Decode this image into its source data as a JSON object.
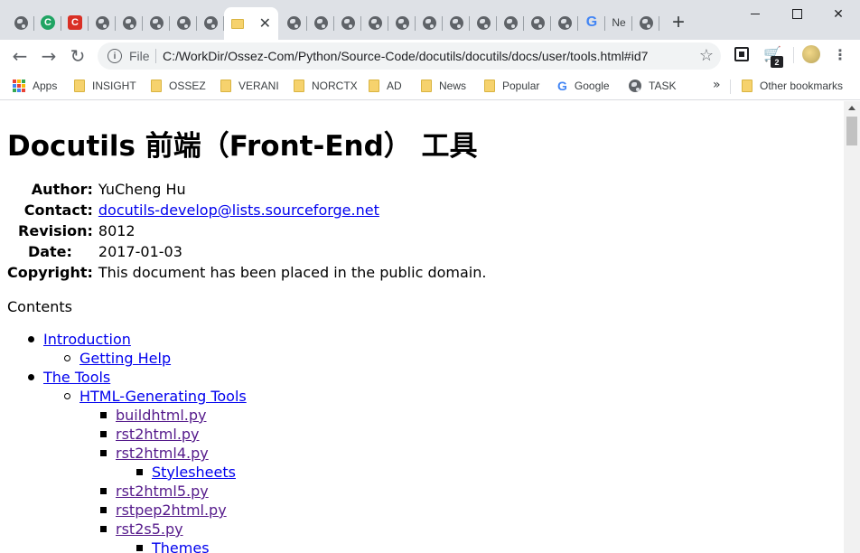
{
  "window": {
    "controls": {
      "minimize_icon": "minimize-icon",
      "maximize_icon": "maximize-icon",
      "close_label": "✕"
    }
  },
  "tabs": [
    {
      "favicon": "globe-icon"
    },
    {
      "favicon": "c-green-icon",
      "glyph": "C"
    },
    {
      "favicon": "c-red-icon",
      "glyph": "C"
    },
    {
      "favicon": "globe-icon"
    },
    {
      "favicon": "globe-icon"
    },
    {
      "favicon": "globe-icon"
    },
    {
      "favicon": "globe-icon"
    },
    {
      "favicon": "globe-icon"
    },
    {
      "favicon": "folder-icon",
      "active": true,
      "close_label": "✕"
    },
    {
      "favicon": "globe-icon"
    },
    {
      "favicon": "globe-icon"
    },
    {
      "favicon": "globe-icon"
    },
    {
      "favicon": "globe-icon"
    },
    {
      "favicon": "globe-icon"
    },
    {
      "favicon": "globe-icon"
    },
    {
      "favicon": "globe-icon"
    },
    {
      "favicon": "globe-icon"
    },
    {
      "favicon": "globe-icon"
    },
    {
      "favicon": "globe-icon"
    },
    {
      "favicon": "globe-icon"
    },
    {
      "favicon": "google-icon",
      "glyph": "G"
    },
    {
      "favicon": "text-icon",
      "glyph": "Ne"
    },
    {
      "favicon": "globe-icon"
    }
  ],
  "new_tab_label": "+",
  "toolbar": {
    "back_label": "←",
    "forward_label": "→",
    "reload_label": "↻",
    "omnibox": {
      "info_label": "i",
      "scheme": "File",
      "url": "C:/WorkDir/Ossez-Com/Python/Source-Code/docutils/docutils/docs/user/tools.html#id7",
      "star_label": "☆"
    },
    "extension_badge": "2",
    "menu_label": "⋮"
  },
  "bookmarks": {
    "items": [
      {
        "label": "Apps",
        "icon": "apps-grid-icon"
      },
      {
        "label": "INSIGHT",
        "icon": "folder-icon"
      },
      {
        "label": "OSSEZ",
        "icon": "folder-icon"
      },
      {
        "label": "VERANI",
        "icon": "folder-icon"
      },
      {
        "label": "NORCTX",
        "icon": "folder-icon"
      },
      {
        "label": "AD",
        "icon": "folder-icon"
      },
      {
        "label": "News",
        "icon": "folder-icon"
      },
      {
        "label": "Popular",
        "icon": "folder-icon"
      },
      {
        "label": "Google",
        "icon": "google-icon"
      },
      {
        "label": "TASK",
        "icon": "globe-icon"
      }
    ],
    "overflow_label": "»",
    "other_label": "Other bookmarks",
    "apps_colors": [
      "#ea4335",
      "#fbbc05",
      "#34a853",
      "#4285f4",
      "#ea4335",
      "#fbbc05",
      "#34a853",
      "#4285f4",
      "#ea4335"
    ]
  },
  "page": {
    "title": "Docutils 前端（Front-End） 工具",
    "docinfo": {
      "author_label": "Author:",
      "author": "YuCheng Hu",
      "contact_label": "Contact:",
      "contact": "docutils-develop@lists.sourceforge.net",
      "revision_label": "Revision:",
      "revision": "8012",
      "date_label": "Date:",
      "date": "2017-01-03",
      "copyright_label": "Copyright:",
      "copyright": "This document has been placed in the public domain."
    },
    "contents_label": "Contents",
    "toc": [
      {
        "label": "Introduction",
        "level": 0,
        "visited": false
      },
      {
        "label": "Getting Help",
        "level": 1,
        "visited": false
      },
      {
        "label": "The Tools",
        "level": 0,
        "visited": false
      },
      {
        "label": "HTML-Generating Tools",
        "level": 1,
        "visited": false
      },
      {
        "label": "buildhtml.py",
        "level": 2,
        "visited": true
      },
      {
        "label": "rst2html.py",
        "level": 2,
        "visited": true
      },
      {
        "label": "rst2html4.py",
        "level": 2,
        "visited": true
      },
      {
        "label": "Stylesheets",
        "level": 3,
        "visited": false
      },
      {
        "label": "rst2html5.py",
        "level": 2,
        "visited": true
      },
      {
        "label": "rstpep2html.py",
        "level": 2,
        "visited": true
      },
      {
        "label": "rst2s5.py",
        "level": 2,
        "visited": true
      },
      {
        "label": "Themes",
        "level": 3,
        "visited": false
      }
    ]
  },
  "colors": {
    "tabstrip_bg": "#dee1e6",
    "link": "#0000ee",
    "link_visited": "#551a8b"
  }
}
